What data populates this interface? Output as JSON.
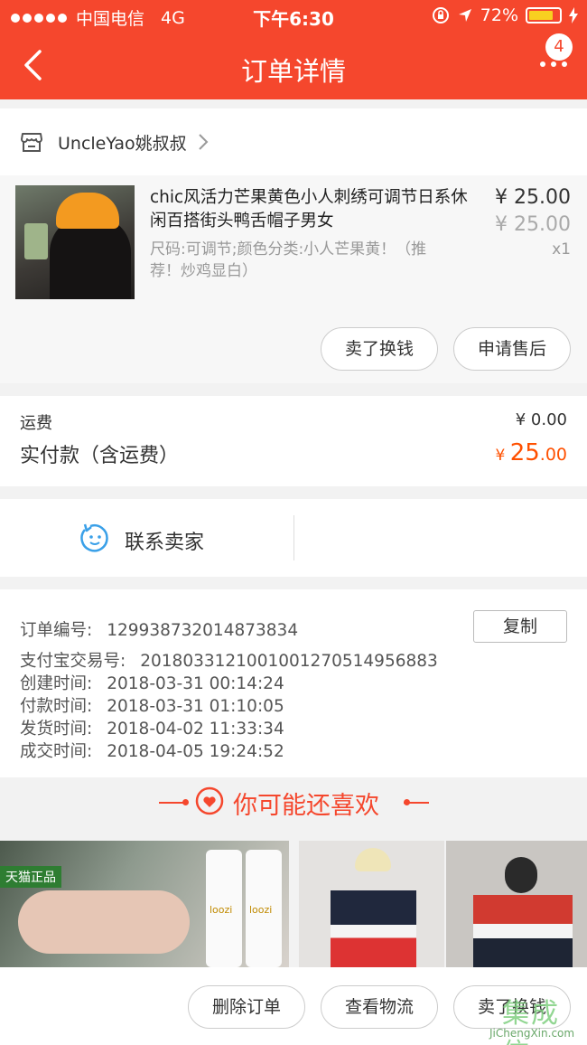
{
  "status_bar": {
    "carrier": "中国电信",
    "network": "4G",
    "time": "下午6:30",
    "battery": "72%"
  },
  "nav": {
    "title": "订单详情",
    "badge_count": "4"
  },
  "store": {
    "name": "UncleYao姚叔叔"
  },
  "product": {
    "title": "chic风活力芒果黄色小人刺绣可调节日系休闲百搭街头鸭舌帽子男女",
    "sku": "尺码:可调节;颜色分类:小人芒果黄！（推荐！炒鸡显白）",
    "price": "¥ 25.00",
    "original_price": "¥ 25.00",
    "quantity": "x1",
    "sell_button": "卖了换钱",
    "aftersale_button": "申请售后"
  },
  "fees": {
    "shipping_label": "运费",
    "shipping_value": "¥ 0.00",
    "paid_label": "实付款（含运费）",
    "paid_currency": "¥ ",
    "paid_integer": "25",
    "paid_decimal": ".00"
  },
  "contact": {
    "label": "联系卖家"
  },
  "order_info": {
    "order_no_label": "订单编号:",
    "order_no": "129938732014873834",
    "copy_button": "复制",
    "alipay_label": "支付宝交易号:",
    "alipay_no": "2018033121001001270514956883",
    "created_label": "创建时间:",
    "created": "2018-03-31 00:14:24",
    "paid_label": "付款时间:",
    "paid": "2018-03-31 01:10:05",
    "shipped_label": "发货时间:",
    "shipped": "2018-04-02 11:33:34",
    "completed_label": "成交时间:",
    "completed": "2018-04-05 19:24:52"
  },
  "recommend": {
    "title": "你可能还喜欢",
    "tile1_tag": "天猫正品",
    "tile1_brand": "loozi"
  },
  "bottom_actions": {
    "delete": "删除订单",
    "logistics": "查看物流",
    "sell": "卖了换钱"
  },
  "watermark": {
    "logo": "集成信",
    "site": "JiChengXin.com"
  },
  "colors": {
    "brand": "#f5472d",
    "price_highlight": "#ff5000"
  },
  "icons": [
    "back-icon",
    "more-icon",
    "store-icon",
    "chevron-right-icon",
    "chat-face-icon",
    "heart-icon",
    "lock-rotation-icon",
    "location-arrow-icon",
    "battery-icon"
  ]
}
